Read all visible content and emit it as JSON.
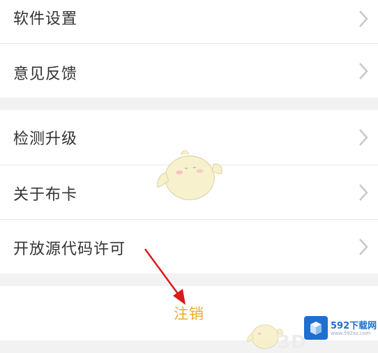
{
  "settings_menu": {
    "group1": [
      {
        "label": "软件设置"
      },
      {
        "label": "意见反馈"
      }
    ],
    "group2": [
      {
        "label": "检测升级"
      },
      {
        "label": "关于布卡"
      },
      {
        "label": "开放源代码许可"
      }
    ]
  },
  "logout": {
    "label": "注销",
    "color": "#f0a830"
  },
  "annotation": {
    "arrow_color": "#d81b1b"
  },
  "watermark": {
    "brand": "592下载网",
    "url": "www.592xz.com",
    "ghost_text": "3D"
  },
  "icons": {
    "row_chevron": "chevron-right-icon"
  }
}
